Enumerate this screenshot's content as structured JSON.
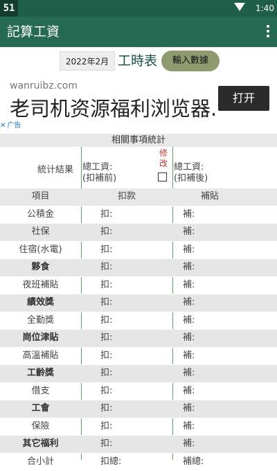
{
  "status_bar": {
    "logo": "51",
    "time": "1:40"
  },
  "app_bar": {
    "title": "記算工資"
  },
  "date_row": {
    "month": "2022年2月",
    "worktime_label": "工時表",
    "input_button": "輸入數據"
  },
  "ad": {
    "domain": "wanruibz.com",
    "text": "老司机资源福利浏览器.",
    "open_button": "打开",
    "label": "广告"
  },
  "stats": {
    "title": "相關事項統計",
    "result_label": "統计結果",
    "total_before": "總工資:(扣補前)",
    "total_before_l1": "總工資:",
    "total_before_l2": "(扣補前)",
    "modify_label": "修改",
    "total_after_l1": "總工資:",
    "total_after_l2": "(扣補後)"
  },
  "table": {
    "headers": {
      "item": "項目",
      "deduction": "扣款",
      "subsidy": "補貼"
    },
    "rows": [
      {
        "item": "公積金",
        "deduction": "扣:",
        "subsidy": "補:"
      },
      {
        "item": "社保",
        "deduction": "扣:",
        "subsidy": "補:"
      },
      {
        "item": "住宿(水電)",
        "deduction": "扣:",
        "subsidy": "補:"
      },
      {
        "item": "夥食",
        "deduction": "扣:",
        "subsidy": "補:"
      },
      {
        "item": "夜班補貼",
        "deduction": "扣:",
        "subsidy": "補:"
      },
      {
        "item": "績效獎",
        "deduction": "扣:",
        "subsidy": "補:"
      },
      {
        "item": "全勤獎",
        "deduction": "扣:",
        "subsidy": "補:"
      },
      {
        "item": "崗位津貼",
        "deduction": "扣:",
        "subsidy": "補:"
      },
      {
        "item": "高溫補貼",
        "deduction": "扣:",
        "subsidy": "補:"
      },
      {
        "item": "工齡獎",
        "deduction": "扣:",
        "subsidy": "補:"
      },
      {
        "item": "借支",
        "deduction": "扣:",
        "subsidy": "補:"
      },
      {
        "item": "工會",
        "deduction": "扣:",
        "subsidy": "補:"
      },
      {
        "item": "保險",
        "deduction": "扣:",
        "subsidy": "補:"
      },
      {
        "item": "其它福利",
        "deduction": "扣:",
        "subsidy": "補:"
      },
      {
        "item": "合小計",
        "deduction": "扣總:",
        "subsidy": "補總:"
      }
    ]
  },
  "colors": {
    "status_bar": "#1f5f4a",
    "app_bar": "#266a54",
    "accent_line": "#5aa566",
    "input_button": "#8f9a6e"
  },
  "icons": {
    "wifi": "wifi-icon",
    "menu": "overflow-menu-icon",
    "ad_close": "close-icon"
  }
}
